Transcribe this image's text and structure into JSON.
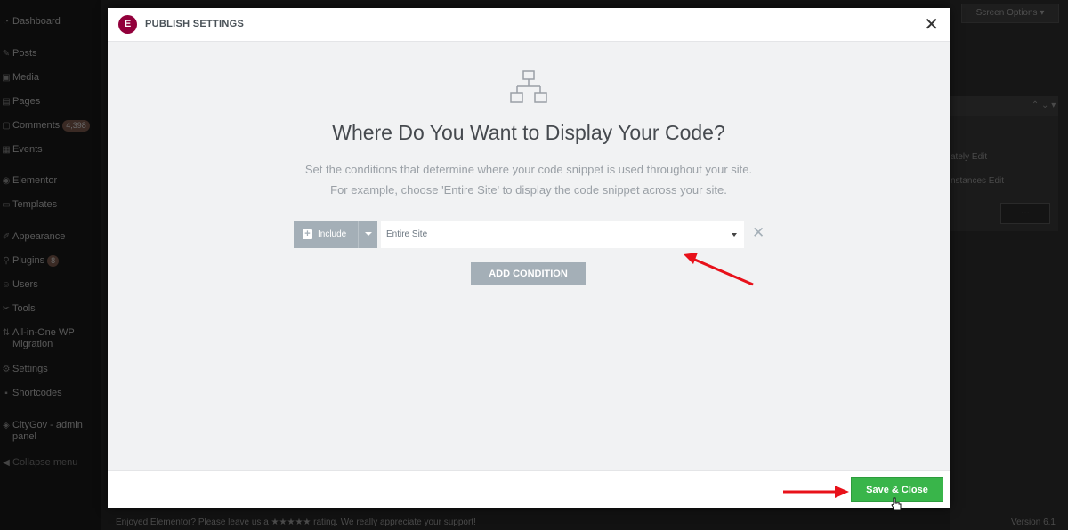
{
  "sidebar": {
    "items": [
      {
        "label": "Dashboard",
        "icon": "dashboard-icon"
      },
      {
        "label": "Posts",
        "icon": "pin-icon"
      },
      {
        "label": "Media",
        "icon": "media-icon"
      },
      {
        "label": "Pages",
        "icon": "page-icon"
      },
      {
        "label": "Comments",
        "icon": "comment-icon",
        "badge": "4,398"
      },
      {
        "label": "Events",
        "icon": "calendar-icon"
      },
      {
        "label": "Elementor",
        "icon": "elementor-icon"
      },
      {
        "label": "Templates",
        "icon": "folder-icon"
      },
      {
        "label": "Appearance",
        "icon": "brush-icon"
      },
      {
        "label": "Plugins",
        "icon": "plugin-icon",
        "badge": "8"
      },
      {
        "label": "Users",
        "icon": "user-icon"
      },
      {
        "label": "Tools",
        "icon": "wrench-icon"
      },
      {
        "label": "All-in-One WP Migration",
        "icon": "migration-icon"
      },
      {
        "label": "Settings",
        "icon": "settings-icon"
      },
      {
        "label": "Shortcodes",
        "icon": "shortcode-icon"
      },
      {
        "label": "CityGov - admin panel",
        "icon": "panel-icon"
      },
      {
        "label": "Collapse menu",
        "icon": "collapse-icon"
      }
    ]
  },
  "background": {
    "screen_options": "Screen Options",
    "right_text_1": "ately Edit",
    "right_text_2": "nstances Edit",
    "footer": "Enjoyed Elementor? Please leave us a ★★★★★ rating. We really appreciate your support!",
    "version": "Version 6.1"
  },
  "modal": {
    "title": "PUBLISH SETTINGS",
    "logo_letter": "E",
    "heading": "Where Do You Want to Display Your Code?",
    "desc_line1": "Set the conditions that determine where your code snippet is used throughout your site.",
    "desc_line2": "For example, choose 'Entire Site' to display the code snippet across your site.",
    "condition": {
      "type": "Include",
      "value": "Entire Site"
    },
    "add_condition": "ADD CONDITION",
    "save_close": "Save & Close"
  },
  "colors": {
    "brand": "#92003b",
    "save_green": "#39b54a",
    "annotation_red": "#e8111a"
  }
}
